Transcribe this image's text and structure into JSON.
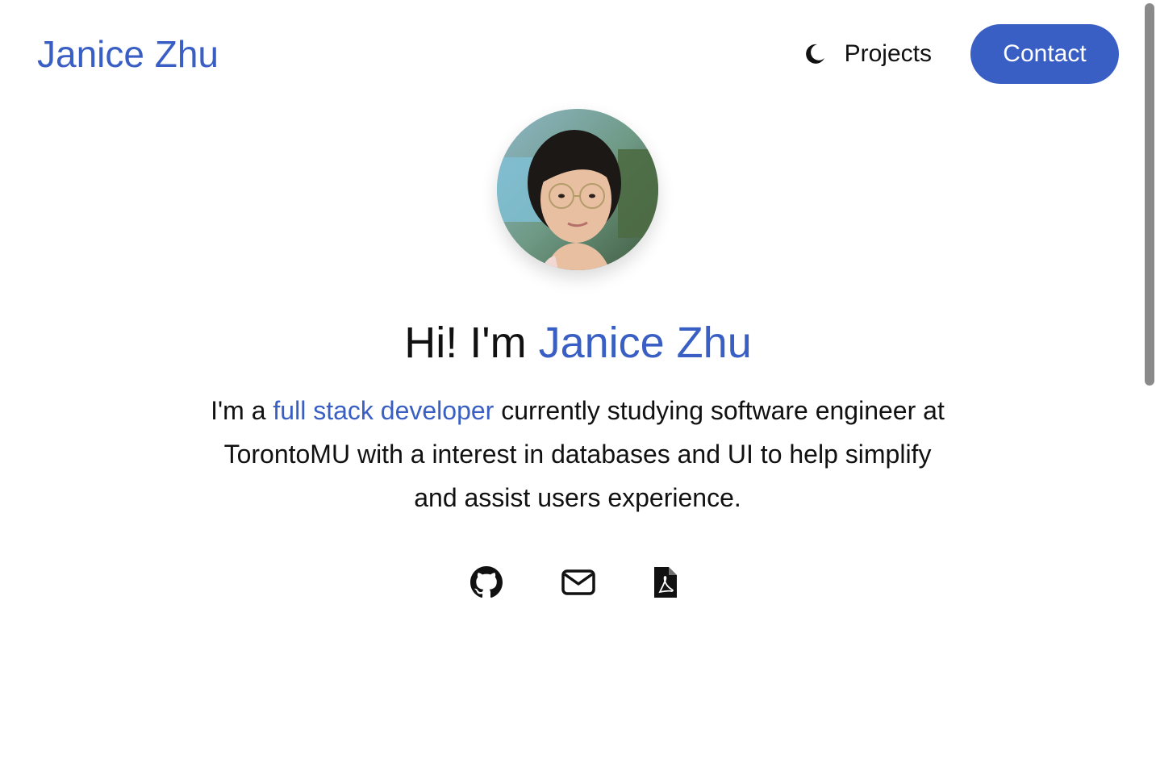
{
  "header": {
    "brand": "Janice Zhu",
    "theme_icon": "moon-icon",
    "nav_projects": "Projects",
    "contact_label": "Contact"
  },
  "hero": {
    "avatar_icon": "profile-photo",
    "greeting": "Hi! I'm ",
    "name": "Janice Zhu",
    "bio_prefix": "I'm a ",
    "bio_role": "full stack developer",
    "bio_rest": " currently studying software engineer at TorontoMU with a interest in databases and UI to help simplify and assist users experience."
  },
  "socials": [
    {
      "icon": "github-icon"
    },
    {
      "icon": "mail-icon"
    },
    {
      "icon": "pdf-icon"
    }
  ],
  "colors": {
    "accent": "#3a5fc4",
    "text": "#111111",
    "background": "#ffffff"
  }
}
